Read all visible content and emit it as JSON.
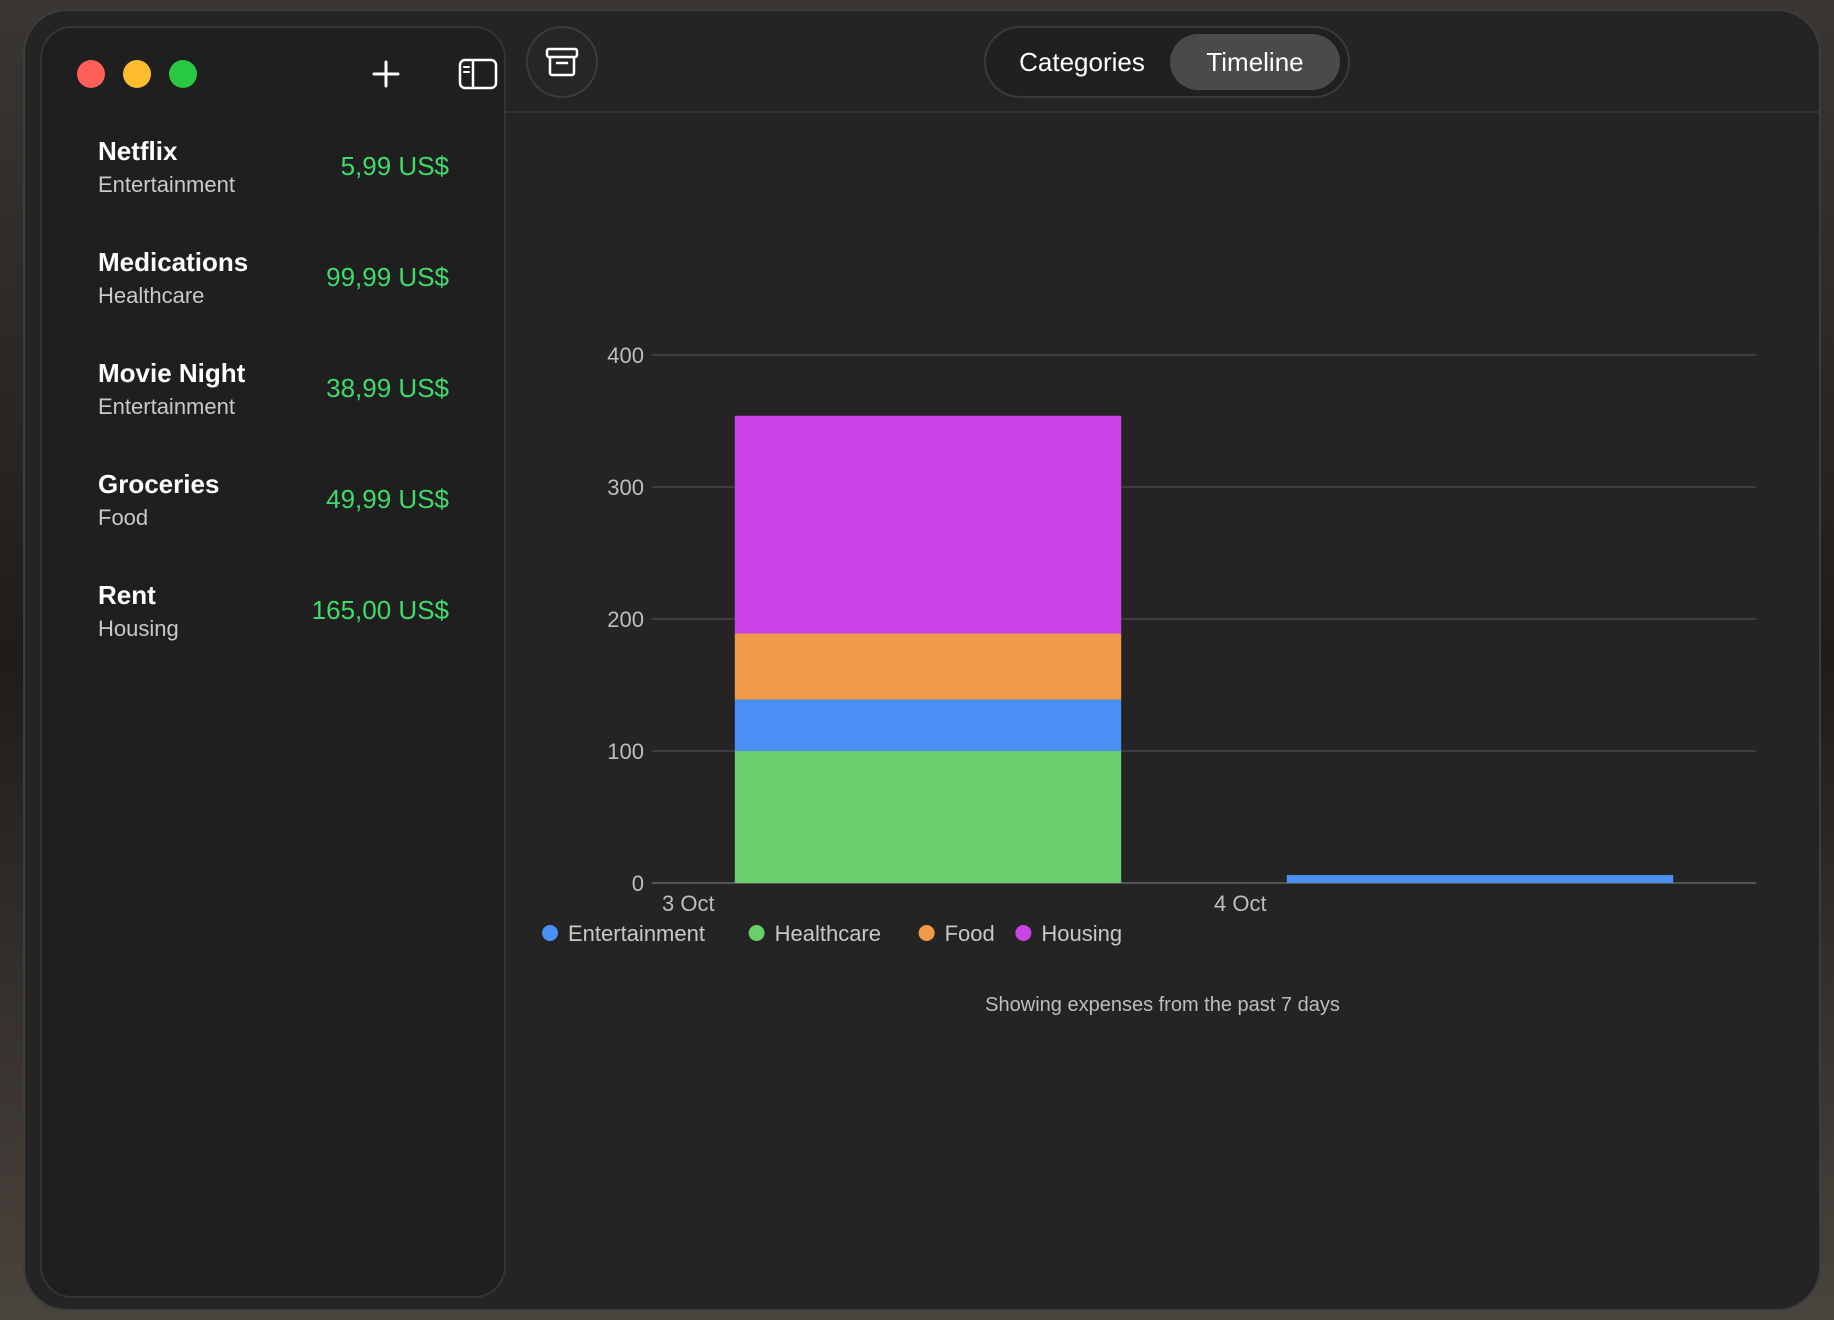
{
  "sidebar": {
    "items": [
      {
        "name": "Netflix",
        "category": "Entertainment",
        "amount": "5,99 US$"
      },
      {
        "name": "Medications",
        "category": "Healthcare",
        "amount": "99,99 US$"
      },
      {
        "name": "Movie Night",
        "category": "Entertainment",
        "amount": "38,99 US$"
      },
      {
        "name": "Groceries",
        "category": "Food",
        "amount": "49,99 US$"
      },
      {
        "name": "Rent",
        "category": "Housing",
        "amount": "165,00 US$"
      }
    ]
  },
  "toolbar": {
    "segments": [
      "Categories",
      "Timeline"
    ],
    "selected": "Timeline"
  },
  "chart_data": {
    "type": "bar",
    "stacked": true,
    "categories": [
      "3 Oct",
      "4 Oct"
    ],
    "series": [
      {
        "name": "Entertainment",
        "color": "#4a90f5",
        "values": [
          38.99,
          5.99
        ]
      },
      {
        "name": "Healthcare",
        "color": "#68cf6a",
        "values": [
          99.99,
          0
        ]
      },
      {
        "name": "Food",
        "color": "#f09a48",
        "values": [
          49.99,
          0
        ]
      },
      {
        "name": "Housing",
        "color": "#c943e6",
        "values": [
          165.0,
          0
        ]
      }
    ],
    "stack_order": [
      "Healthcare",
      "Entertainment",
      "Food",
      "Housing"
    ],
    "yticks": [
      0,
      100,
      200,
      300,
      400
    ],
    "ylim": [
      0,
      400
    ],
    "grid": true,
    "legend": "bottom-left"
  },
  "caption": "Showing expenses from the past 7 days"
}
